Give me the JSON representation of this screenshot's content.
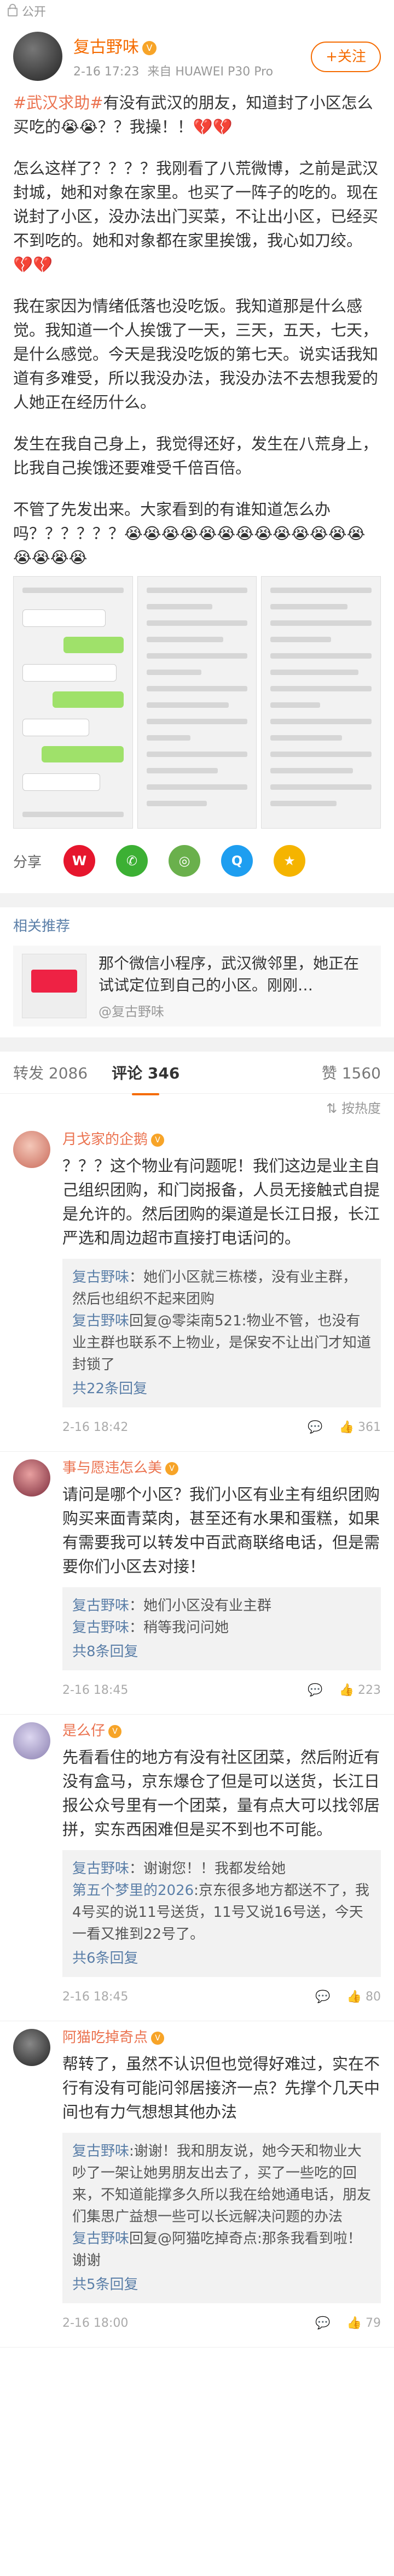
{
  "topbar": {
    "label": "公开"
  },
  "post": {
    "author": "复古野味",
    "vip_badge": "V",
    "time": "2-16 17:23",
    "source": "来自 HUAWEI P30 Pro",
    "follow_label": "+关注",
    "paragraphs": [
      [
        "#武汉求助#",
        "有没有武汉的朋友，知道封了小区怎么买吃的😭😭？？我操！！💔💔"
      ],
      [
        "",
        "怎么这样了？？？？我刚看了八荒微博，之前是武汉封城，她和对象在家里。也买了一阵子的吃的。现在说封了小区，没办法出门买菜，不让出小区，已经买不到吃的。她和对象都在家里挨饿，我心如刀绞。💔💔"
      ],
      [
        "",
        "我在家因为情绪低落也没吃饭。我知道那是什么感觉。我知道一个人挨饿了一天，三天，五天，七天，是什么感觉。今天是我没吃饭的第七天。说实话我知道有多难受，所以我没办法，我没办法不去想我爱的人她正在经历什么。"
      ],
      [
        "",
        "发生在我自己身上，我觉得还好，发生在八荒身上，比我自己挨饿还要难受千倍百倍。"
      ],
      [
        "",
        "不管了先发出来。大家看到的有谁知道怎么办吗？？？？？？😭😭😭😭😭😭😭😭😭😭😭😭😭😭😭😭😭"
      ]
    ]
  },
  "footer": {
    "share_label": "分享"
  },
  "recommend": {
    "title": "相关推荐",
    "card_text": "那个微信小程序，武汉微邻里，她正在试试定位到自己的小区。刚刚…",
    "card_author": "@复古野味"
  },
  "tabs": {
    "reposts": "转发 2086",
    "comments": "评论 346",
    "likes": "赞 1560"
  },
  "sort": {
    "label": "按热度"
  },
  "comments": [
    {
      "name": "月戈家的企鹅",
      "text": "？？？这个物业有问题呢！我们这边是业主自己组织团购，和门岗报备，人员无接触式自提是允许的。然后团购的渠道是长江日报，长江严选和周边超市直接打电话问的。",
      "replies": [
        {
          "name": "复古野味",
          "text": "：她们小区就三栋楼，没有业主群，然后也组织不起来团购"
        },
        {
          "name": "复古野味",
          "text": "回复@零柒南521:物业不管，也没有业主群也联系不上物业，是保安不让出门才知道封锁了"
        }
      ],
      "more": "共22条回复",
      "time": "2-16 18:42",
      "likes": "361"
    },
    {
      "name": "事与愿违怎么美",
      "text": "请问是哪个小区？我们小区有业主有组织团购购买来面青菜肉，甚至还有水果和蛋糕，如果有需要我可以转发中百武商联络电话，但是需要你们小区去对接！",
      "replies": [
        {
          "name": "复古野味",
          "text": "：她们小区没有业主群"
        },
        {
          "name": "复古野味",
          "text": "：稍等我问问她"
        }
      ],
      "more": "共8条回复",
      "time": "2-16 18:45",
      "likes": "223"
    },
    {
      "name": "是么仔",
      "text": "先看看住的地方有没有社区团菜，然后附近有没有盒马，京东爆仓了但是可以送货，长江日报公众号里有一个团菜，量有点大可以找邻居拼，实东西困难但是买不到也不可能。",
      "replies": [
        {
          "name": "复古野味",
          "text": "：谢谢您！！我都发给她"
        },
        {
          "name": "第五个梦里的2026",
          "text": ":京东很多地方都送不了，我4号买的说11号送货，11号又说16号送，今天一看又推到22号了。"
        }
      ],
      "more": "共6条回复",
      "time": "2-16 18:45",
      "likes": "80"
    },
    {
      "name": "阿猫吃掉奇点",
      "text": "帮转了，虽然不认识但也觉得好难过，实在不行有没有可能问邻居接济一点？先撑个几天中间也有力气想想其他办法",
      "replies": [
        {
          "name": "复古野味",
          "text": ":谢谢！我和朋友说，她今天和物业大吵了一架让她男朋友出去了，买了一些吃的回来，不知道能撑多久所以我在给她通电话，朋友们集思广益想一些可以长远解决问题的办法"
        },
        {
          "name": "复古野味",
          "text": "回复@阿猫吃掉奇点:那条我看到啦！谢谢"
        }
      ],
      "more": "共5条回复",
      "time": "2-16 18:00",
      "likes": "79"
    }
  ]
}
